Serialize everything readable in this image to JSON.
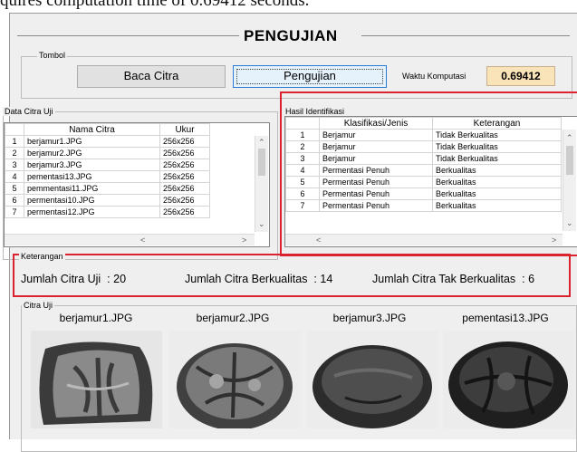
{
  "caption": "quires computation time of 0.69412 seconds.",
  "window": {
    "title": "PENGUJIAN"
  },
  "tombol": {
    "group_label": "Tombol",
    "baca_label": "Baca Citra",
    "pengujian_label": "Pengujian",
    "waktu_label": "Waktu Komputasi",
    "waktu_value": "0.69412"
  },
  "data_citra": {
    "group_label": "Data Citra Uji",
    "headers": [
      "",
      "Nama Citra",
      "Ukur"
    ],
    "rows": [
      [
        "1",
        "berjamur1.JPG",
        "256x256"
      ],
      [
        "2",
        "berjamur2.JPG",
        "256x256"
      ],
      [
        "3",
        "berjamur3.JPG",
        "256x256"
      ],
      [
        "4",
        "pementasi13.JPG",
        "256x256"
      ],
      [
        "5",
        "pemmentasi11.JPG",
        "256x256"
      ],
      [
        "6",
        "permentasi10.JPG",
        "256x256"
      ],
      [
        "7",
        "permentasi12.JPG",
        "256x256"
      ]
    ]
  },
  "hasil": {
    "group_label": "Hasil Identifikasi",
    "headers": [
      "",
      "Klasifikasi/Jenis",
      "Keterangan"
    ],
    "rows": [
      [
        "1",
        "Berjamur",
        "Tidak Berkualitas"
      ],
      [
        "2",
        "Berjamur",
        "Tidak Berkualitas"
      ],
      [
        "3",
        "Berjamur",
        "Tidak Berkualitas"
      ],
      [
        "4",
        "Permentasi Penuh",
        "Berkualitas"
      ],
      [
        "5",
        "Permentasi Penuh",
        "Berkualitas"
      ],
      [
        "6",
        "Permentasi Penuh",
        "Berkualitas"
      ],
      [
        "7",
        "Permentasi Penuh",
        "Berkualitas"
      ]
    ]
  },
  "keterangan": {
    "group_label": "Keterangan",
    "uji_label": "Jumlah Citra Uji",
    "uji_value": ": 20",
    "berkualitas_label": "Jumlah Citra Berkualitas",
    "berkualitas_value": ": 14",
    "tak_label": "Jumlah Citra Tak Berkualitas",
    "tak_value": ": 6"
  },
  "citra_uji": {
    "group_label": "Citra Uji",
    "images": [
      {
        "name": "berjamur1.JPG"
      },
      {
        "name": "berjamur2.JPG"
      },
      {
        "name": "berjamur3.JPG"
      },
      {
        "name": "pementasi13.JPG"
      }
    ]
  },
  "colors": {
    "highlight_border": "#d9232e",
    "time_bg": "#f9e3b8",
    "active_button_border": "#2b7bd5"
  }
}
